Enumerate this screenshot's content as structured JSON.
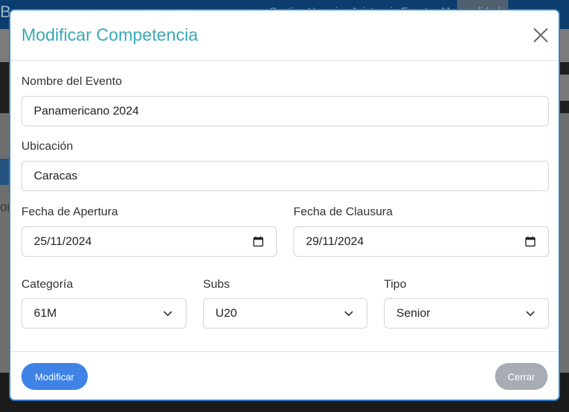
{
  "background": {
    "logo": "B",
    "nav_links": "Gestion   Usuarios   Asistencia   Eventos   Mensualidad",
    "side_text": "on"
  },
  "modal": {
    "title": "Modificar Competencia",
    "close_icon": "close-icon"
  },
  "form": {
    "event_name": {
      "label": "Nombre del Evento",
      "value": "Panamericano 2024"
    },
    "location": {
      "label": "Ubicación",
      "value": "Caracas"
    },
    "open_date": {
      "label": "Fecha de Apertura",
      "value": "25/11/2024",
      "icon": "calendar-icon"
    },
    "close_date": {
      "label": "Fecha de Clausura",
      "value": "29/11/2024",
      "icon": "calendar-icon"
    },
    "category": {
      "label": "Categoría",
      "value": "61M",
      "icon": "chevron-down-icon"
    },
    "subs": {
      "label": "Subs",
      "value": "U20",
      "icon": "chevron-down-icon"
    },
    "type": {
      "label": "Tipo",
      "value": "Senior",
      "icon": "chevron-down-icon"
    }
  },
  "footer": {
    "submit_label": "Modificar",
    "close_label": "Cerrar"
  },
  "colors": {
    "title": "#3aa9b8",
    "primary": "#3f83e6",
    "secondary": "#a8adb3",
    "modal_border": "#2f7fd1"
  }
}
